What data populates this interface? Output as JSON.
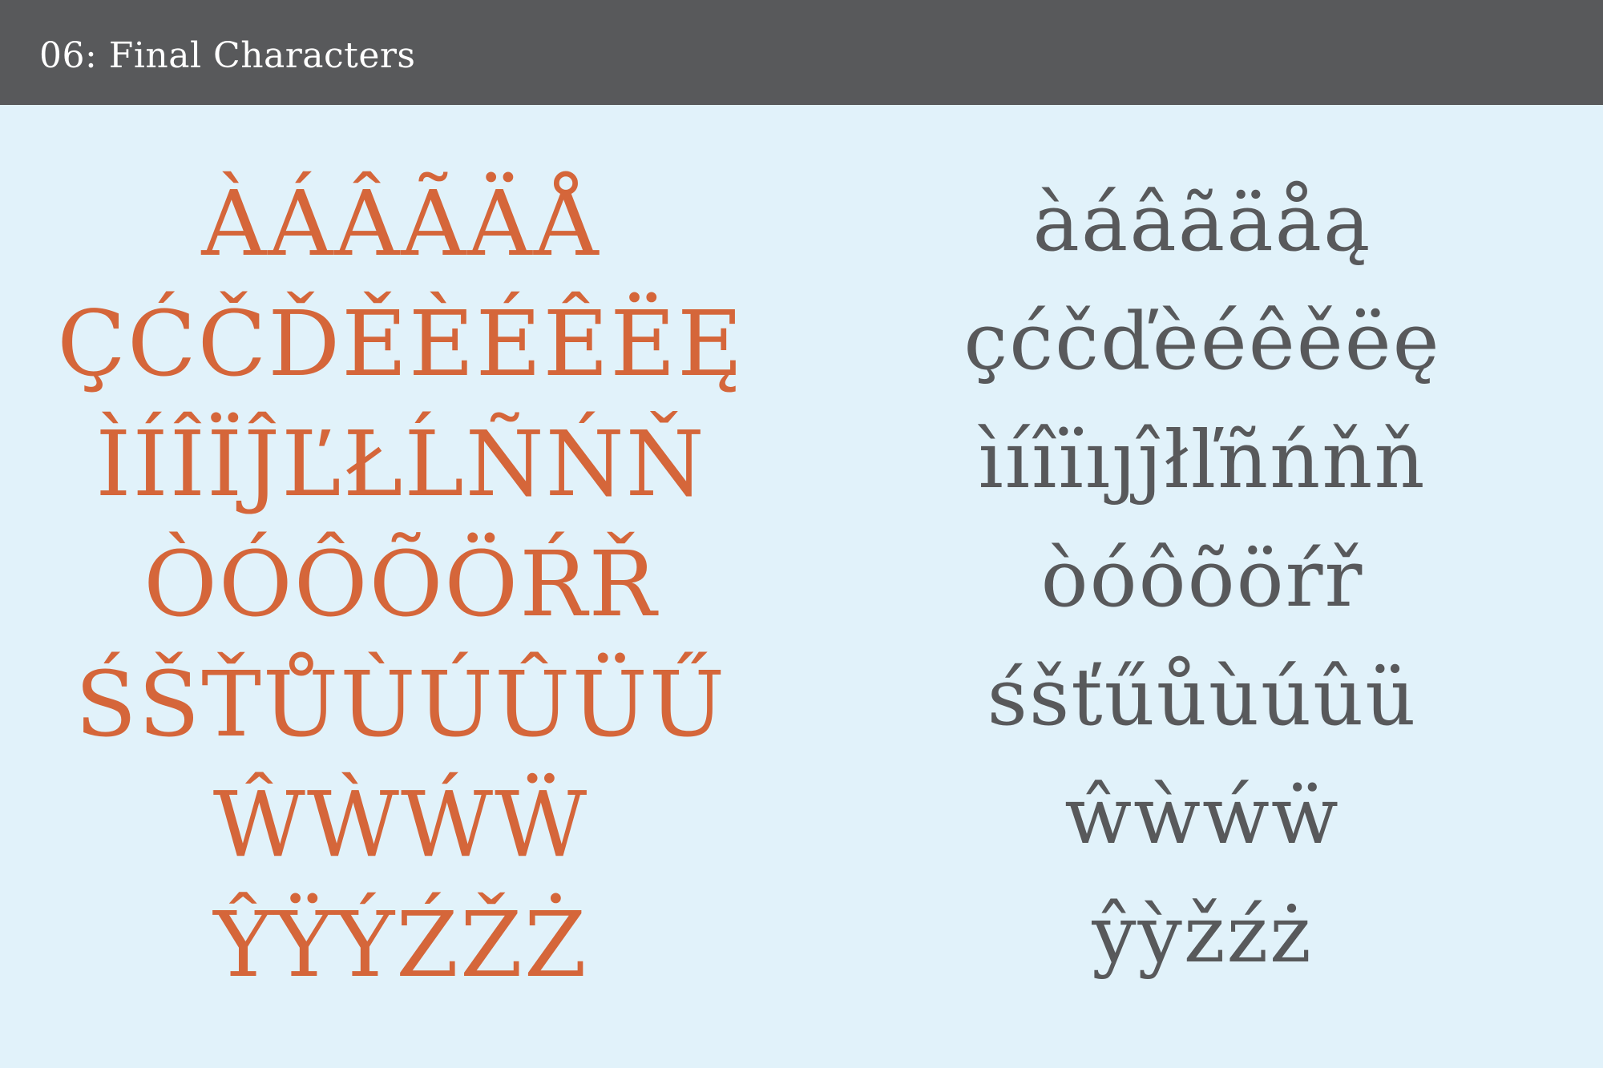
{
  "header": {
    "title": "06: Final Characters",
    "background_color": "#58595b",
    "text_color": "#ffffff"
  },
  "page": {
    "background_color": "#e1f2fa"
  },
  "uppercase": {
    "color": "#d5663a",
    "rows": [
      "ÀÁÂÃÄÅ",
      "ÇĆČĎĚÈÉÊËĘ",
      "ÌÍÎÏĴĽŁĹÑŃŇ",
      "ÒÓÔÕÖŔŘ",
      "ŚŠŤŮÙÚÛÜŰ",
      "ŴẀẂẄ",
      "ŶŸÝŹŽŻ"
    ]
  },
  "lowercase": {
    "color": "#58595b",
    "rows": [
      "àáâãäåą",
      "çćčďèéêěëę",
      "ìíîïıȷĵłľñńňň",
      "òóôõöŕř",
      "śšťűůùúûü",
      "ŵẁẃẅ",
      "ŷỳžźż"
    ]
  }
}
